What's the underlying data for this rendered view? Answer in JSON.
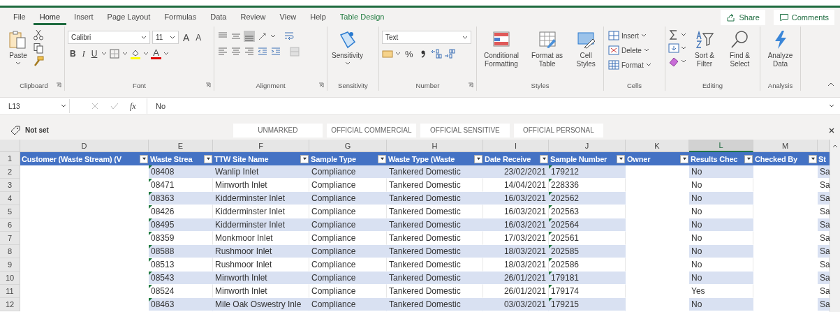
{
  "tabs": [
    {
      "label": "File",
      "selected": false,
      "kind": "standard"
    },
    {
      "label": "Home",
      "selected": true,
      "kind": "standard"
    },
    {
      "label": "Insert",
      "selected": false,
      "kind": "standard"
    },
    {
      "label": "Page Layout",
      "selected": false,
      "kind": "standard"
    },
    {
      "label": "Formulas",
      "selected": false,
      "kind": "standard"
    },
    {
      "label": "Data",
      "selected": false,
      "kind": "standard"
    },
    {
      "label": "Review",
      "selected": false,
      "kind": "standard"
    },
    {
      "label": "View",
      "selected": false,
      "kind": "standard"
    },
    {
      "label": "Help",
      "selected": false,
      "kind": "standard"
    },
    {
      "label": "Table Design",
      "selected": false,
      "kind": "contextual"
    }
  ],
  "share": "Share",
  "comments": "Comments",
  "ribbon": {
    "clipboard": {
      "paste": "Paste",
      "label": "Clipboard"
    },
    "font": {
      "name": "Calibri",
      "size": "11",
      "grow": "A",
      "shrink": "A",
      "bold": "B",
      "italic": "I",
      "underline": "U",
      "color_button": "A",
      "label": "Font"
    },
    "alignment": {
      "label": "Alignment"
    },
    "sensitivity": {
      "button": "Sensitivity",
      "label": "Sensitivity"
    },
    "number": {
      "format": "Text",
      "percent": "%",
      "label": "Number"
    },
    "styles": {
      "buttons": [
        "Conditional Formatting",
        "Format as Table",
        "Cell Styles"
      ],
      "label": "Styles"
    },
    "cells": {
      "buttons": [
        "Insert",
        "Delete",
        "Format"
      ],
      "label": "Cells"
    },
    "editing": {
      "buttons": [
        "Sort & Filter",
        "Find & Select"
      ],
      "label": "Editing"
    },
    "analysis": {
      "buttons": [
        "Analyze Data"
      ],
      "label": "Analysis"
    }
  },
  "formula_bar": {
    "name_box": "L13",
    "function": "fx",
    "value": "No"
  },
  "sensitivity_bar": {
    "current": "Not set",
    "labels": [
      "UNMARKED",
      "OFFICIAL COMMERCIAL",
      "OFFICIAL SENSITIVE",
      "OFFICIAL PERSONAL"
    ]
  },
  "sheet": {
    "columns": [
      {
        "letter": "D",
        "selected": false
      },
      {
        "letter": "E",
        "selected": false
      },
      {
        "letter": "F",
        "selected": false
      },
      {
        "letter": "G",
        "selected": false
      },
      {
        "letter": "H",
        "selected": false
      },
      {
        "letter": "I",
        "selected": false
      },
      {
        "letter": "J",
        "selected": false
      },
      {
        "letter": "K",
        "selected": false
      },
      {
        "letter": "L",
        "selected": true
      },
      {
        "letter": "M",
        "selected": false
      }
    ],
    "header_row": {
      "number": "1",
      "headers": [
        {
          "label": "Customer (Waste Stream) (V",
          "filter": true
        },
        {
          "label": "Waste Strea",
          "filter": true
        },
        {
          "label": "TTW Site Name",
          "filter": true
        },
        {
          "label": "Sample Type",
          "filter": true
        },
        {
          "label": "Waste Type (Waste",
          "filter": true
        },
        {
          "label": "Date Receive",
          "filter": true
        },
        {
          "label": "Sample Number",
          "filter": true
        },
        {
          "label": "Owner",
          "filter": true
        },
        {
          "label": "Results Chec",
          "filter": true
        },
        {
          "label": "Checked By",
          "filter": true
        },
        {
          "label": "St",
          "filter": false
        }
      ]
    },
    "rows": [
      {
        "number": "2",
        "waste_stream": "08408",
        "site_name": "Wanlip Inlet",
        "sample_type": "Compliance",
        "waste_type": "Tankered Domestic",
        "date_received": "23/02/2021",
        "sample_number": "179212",
        "results_checked": "No",
        "column_n": "Sa"
      },
      {
        "number": "3",
        "waste_stream": "08471",
        "site_name": "Minworth Inlet",
        "sample_type": "Compliance",
        "waste_type": "Tankered Domestic",
        "date_received": "14/04/2021",
        "sample_number": "228336",
        "results_checked": "No",
        "column_n": "Sa"
      },
      {
        "number": "4",
        "waste_stream": "08363",
        "site_name": "Kidderminster Inlet",
        "sample_type": "Compliance",
        "waste_type": "Tankered Domestic",
        "date_received": "16/03/2021",
        "sample_number": "202562",
        "results_checked": "No",
        "column_n": "Sa"
      },
      {
        "number": "5",
        "waste_stream": "08426",
        "site_name": "Kidderminster Inlet",
        "sample_type": "Compliance",
        "waste_type": "Tankered Domestic",
        "date_received": "16/03/2021",
        "sample_number": "202563",
        "results_checked": "No",
        "column_n": "Sa"
      },
      {
        "number": "6",
        "waste_stream": "08495",
        "site_name": "Kidderminster Inlet",
        "sample_type": "Compliance",
        "waste_type": "Tankered Domestic",
        "date_received": "16/03/2021",
        "sample_number": "202564",
        "results_checked": "No",
        "column_n": "Sa"
      },
      {
        "number": "7",
        "waste_stream": "08359",
        "site_name": "Monkmoor Inlet",
        "sample_type": "Compliance",
        "waste_type": "Tankered Domestic",
        "date_received": "17/03/2021",
        "sample_number": "202561",
        "results_checked": "No",
        "column_n": "Sa"
      },
      {
        "number": "8",
        "waste_stream": "08588",
        "site_name": "Rushmoor Inlet",
        "sample_type": "Compliance",
        "waste_type": "Tankered Domestic",
        "date_received": "18/03/2021",
        "sample_number": "202585",
        "results_checked": "No",
        "column_n": "Sa"
      },
      {
        "number": "9",
        "waste_stream": "08513",
        "site_name": "Rushmoor Inlet",
        "sample_type": "Compliance",
        "waste_type": "Tankered Domestic",
        "date_received": "18/03/2021",
        "sample_number": "202586",
        "results_checked": "No",
        "column_n": "Sa"
      },
      {
        "number": "10",
        "waste_stream": "08543",
        "site_name": "Minworth Inlet",
        "sample_type": "Compliance",
        "waste_type": "Tankered Domestic",
        "date_received": "26/01/2021",
        "sample_number": "179181",
        "results_checked": "No",
        "column_n": "Sa"
      },
      {
        "number": "11",
        "waste_stream": "08524",
        "site_name": "Minworth Inlet",
        "sample_type": "Compliance",
        "waste_type": "Tankered Domestic",
        "date_received": "26/01/2021",
        "sample_number": "179174",
        "results_checked": "Yes",
        "column_n": "Sa"
      },
      {
        "number": "12",
        "waste_stream": "08463",
        "site_name": "Mile Oak Oswestry Inle",
        "sample_type": "Compliance",
        "waste_type": "Tankered Domestic",
        "date_received": "03/03/2021",
        "sample_number": "179215",
        "results_checked": "No",
        "column_n": "Sa"
      }
    ]
  }
}
